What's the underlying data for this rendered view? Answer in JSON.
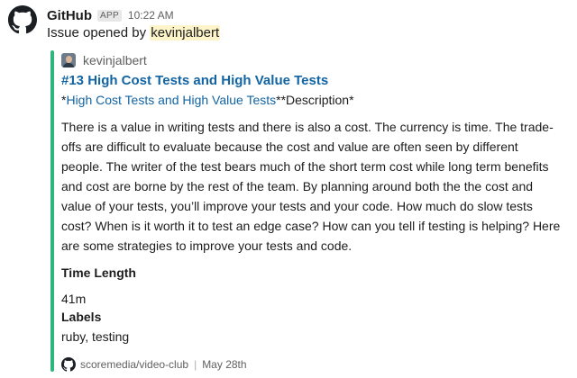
{
  "message": {
    "app_name": "GitHub",
    "app_badge": "APP",
    "timestamp": "10:22 AM",
    "subline_prefix": "Issue opened by ",
    "subline_user": "kevinjalbert"
  },
  "attachment": {
    "accent_color": "#2eb67d",
    "author_name": "kevinjalbert",
    "title": "#13 High Cost Tests and High Value Tests",
    "desc_prefix": "*",
    "desc_link": "High Cost Tests and High Value Tests",
    "desc_suffix": "**Description*",
    "body": "There is a value in writing tests and there is also a cost. The currency is time. The trade-offs are difficult to evaluate because the cost and value are often seen by different people. The writer of the test bears much of the short term cost while long term benefits and cost are borne by the rest of the team. By planning around both the the cost and value of your tests, you’ll improve your tests and your code. How much do slow tests cost? When is it worth it to test an edge case? How can you tell if testing is helping? Here are some strategies to improve your tests and code.",
    "fields": [
      {
        "title": "Time Length",
        "value": "41m"
      },
      {
        "title": "Labels",
        "value": "ruby, testing"
      }
    ],
    "footer_repo": "scoremedia/video-club",
    "footer_sep": "|",
    "footer_date": "May 28th"
  },
  "icons": {
    "app_avatar": "github-octocat-icon",
    "footer_icon": "github-octocat-icon",
    "author_avatar": "user-avatar"
  }
}
